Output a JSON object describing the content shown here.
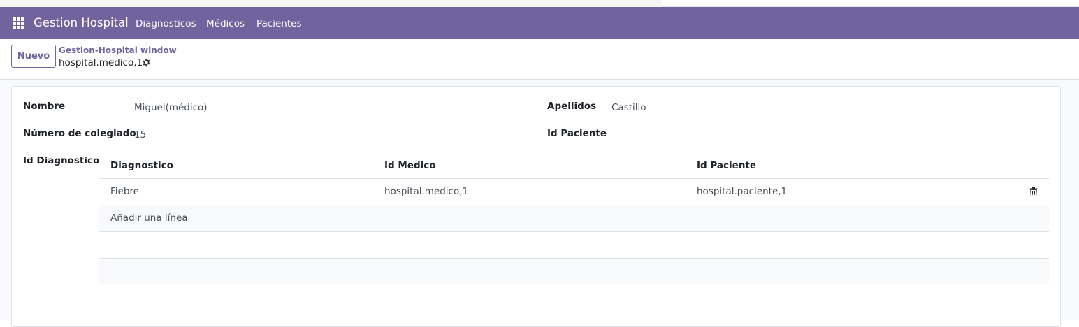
{
  "navbar": {
    "brand": "Gestion Hospital",
    "items": [
      {
        "label": "Diagnosticos"
      },
      {
        "label": "Médicos"
      },
      {
        "label": "Pacientes"
      }
    ],
    "color": "#71639e"
  },
  "control_panel": {
    "new_button": "Nuevo",
    "breadcrumb": "Gestion-Hospital window",
    "record_name": "hospital.medico,1"
  },
  "form": {
    "nombre_label": "Nombre",
    "nombre_value": "Miguel(médico)",
    "apellidos_label": "Apellidos",
    "apellidos_value": "Castillo",
    "colegiado_label": "Número de colegiado",
    "colegiado_value": "15",
    "id_paciente_label": "Id Paciente",
    "id_diagnostico_label": "Id Diagnostico"
  },
  "table": {
    "columns": [
      "Diagnostico",
      "Id Medico",
      "Id Paciente"
    ],
    "rows": [
      {
        "diagnostico": "Fiebre",
        "id_medico": "hospital.medico,1",
        "id_paciente": "hospital.paciente,1"
      }
    ],
    "add_line": "Añadir una línea"
  }
}
